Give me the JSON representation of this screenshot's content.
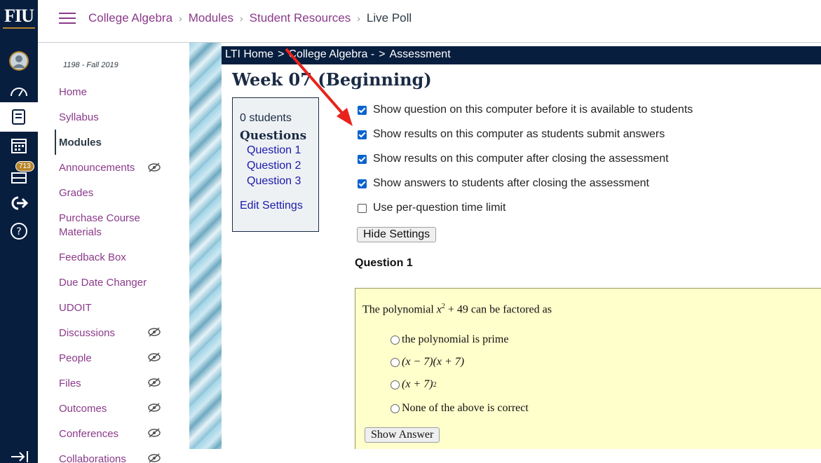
{
  "global_nav": {
    "logo": "FIU",
    "inbox_badge": "713"
  },
  "header": {
    "breadcrumbs": [
      "College Algebra",
      "Modules",
      "Student Resources",
      "Live Poll"
    ]
  },
  "course_nav": {
    "term": "1198 - Fall 2019",
    "items": [
      {
        "label": "Home"
      },
      {
        "label": "Syllabus"
      },
      {
        "label": "Modules"
      },
      {
        "label": "Announcements"
      },
      {
        "label": "Grades"
      },
      {
        "label": "Purchase Course Materials"
      },
      {
        "label": "Feedback Box"
      },
      {
        "label": "Due Date Changer"
      },
      {
        "label": "UDOIT"
      },
      {
        "label": "Discussions"
      },
      {
        "label": "People"
      },
      {
        "label": "Files"
      },
      {
        "label": "Outcomes"
      },
      {
        "label": "Conferences"
      },
      {
        "label": "Collaborations"
      }
    ]
  },
  "lti": {
    "breadcrumbs": [
      "LTI Home",
      "College Algebra -",
      "Assessment"
    ],
    "separator": ">",
    "title": "Week 07 (Beginning)",
    "sidebar": {
      "students": "0 students",
      "questions_heading": "Questions",
      "questions": [
        "Question 1",
        "Question 2",
        "Question 3"
      ],
      "edit_settings": "Edit Settings"
    },
    "settings": [
      {
        "label": "Show question on this computer before it is available to students",
        "checked": true
      },
      {
        "label": "Show results on this computer as students submit answers",
        "checked": true
      },
      {
        "label": "Show results on this computer after closing the assessment",
        "checked": true
      },
      {
        "label": "Show answers to students after closing the assessment",
        "checked": true
      },
      {
        "label": "Use per-question time limit",
        "checked": false
      }
    ],
    "hide_settings": "Hide Settings",
    "question_heading": "Question 1",
    "question": {
      "prompt_before": "The polynomial",
      "prompt_after": "can be factored as",
      "options": [
        "the polynomial is prime",
        "(x − 7)(x + 7)",
        "(x + 7)",
        "None of the above is correct"
      ],
      "show_answer": "Show Answer"
    }
  },
  "colors": {
    "nav_bg": "#081e3f",
    "link": "#8a3a8a",
    "accent_gold": "#b6862c",
    "question_bg": "#ffffcc",
    "annotation_arrow": "#e8231c"
  }
}
